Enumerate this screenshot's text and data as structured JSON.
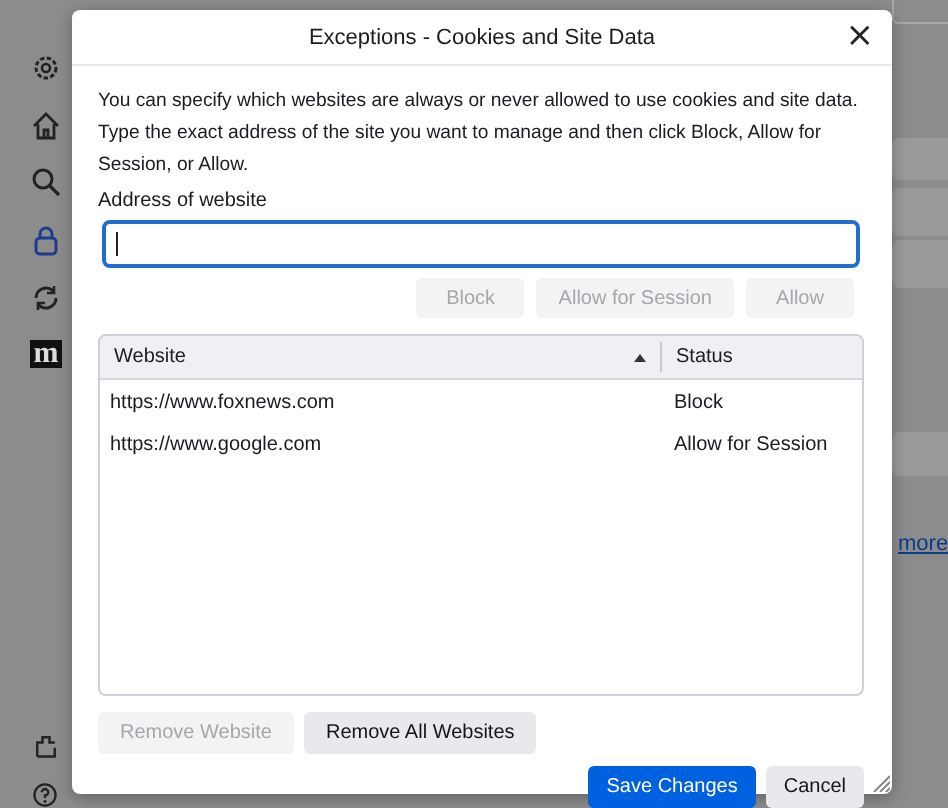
{
  "background": {
    "sidebar_icons": [
      {
        "kind": "gear",
        "selected": false
      },
      {
        "kind": "home",
        "selected": false
      },
      {
        "kind": "search",
        "selected": false
      },
      {
        "kind": "lock",
        "selected": true
      },
      {
        "kind": "sync",
        "selected": false
      },
      {
        "kind": "logo",
        "label": "m",
        "selected": false
      }
    ],
    "link": "more"
  },
  "dialog": {
    "title": "Exceptions - Cookies and Site Data",
    "close": "×",
    "description": "You can specify which websites are always or never allowed to use cookies and site data. Type the exact address of the site you want to manage and then click Block, Allow for Session, or Allow.",
    "address_label": "Address of website",
    "action_buttons": [
      {
        "label": "Block",
        "disabled": true
      },
      {
        "label": "Allow for Session",
        "disabled": true
      },
      {
        "label": "Allow",
        "disabled": true
      }
    ],
    "table": {
      "columns": [
        {
          "label": "Website",
          "sorted": true
        },
        {
          "label": "Status",
          "sorted": false
        }
      ],
      "rows": [
        {
          "website": "https://www.foxnews.com",
          "status": "Block",
          "selected": false
        },
        {
          "website": "https://www.google.com",
          "status": "Allow for Session",
          "selected": false
        }
      ]
    },
    "list_buttons": [
      {
        "label": "Remove Website",
        "disabled": true
      },
      {
        "label": "Remove All Websites",
        "disabled": false
      }
    ],
    "footer_buttons": [
      {
        "label": "Save Changes",
        "kind": "primary"
      },
      {
        "label": "Cancel",
        "kind": "secondary"
      }
    ]
  }
}
